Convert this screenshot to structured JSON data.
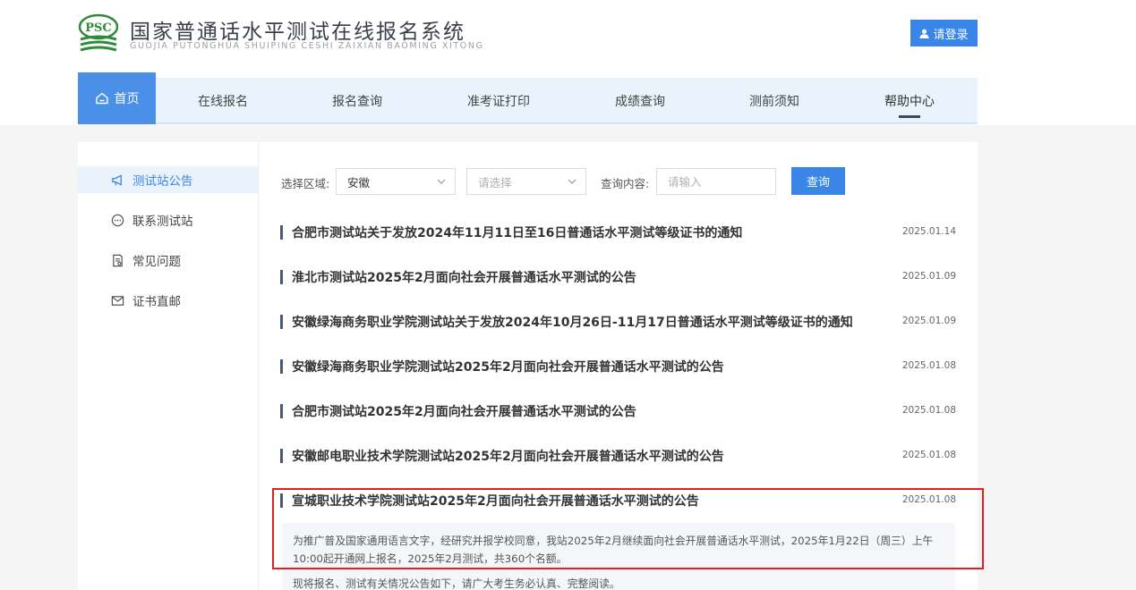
{
  "header": {
    "logo_mark": "PSC",
    "title": "国家普通话水平测试在线报名系统",
    "subtitle": "GUOJIA PUTONGHUA SHUIPING CESHI ZAIXIAN BAOMING XITONG",
    "login_label": "请登录",
    "login_icon": "user-icon"
  },
  "nav": {
    "items": [
      {
        "label": "首页",
        "icon": "home-icon",
        "state": "selected"
      },
      {
        "label": "在线报名"
      },
      {
        "label": "报名查询"
      },
      {
        "label": "准考证打印"
      },
      {
        "label": "成绩查询"
      },
      {
        "label": "测前须知"
      },
      {
        "label": "帮助中心",
        "state": "underlined"
      }
    ]
  },
  "sidebar": {
    "items": [
      {
        "label": "测试站公告",
        "icon": "megaphone-icon",
        "active": true
      },
      {
        "label": "联系测试站",
        "icon": "chat-icon"
      },
      {
        "label": "常见问题",
        "icon": "document-icon"
      },
      {
        "label": "证书直邮",
        "icon": "mail-icon"
      }
    ]
  },
  "filters": {
    "region_label": "选择区域:",
    "region_value": "安徽",
    "city_placeholder": "请选择",
    "query_label": "查询内容:",
    "query_placeholder": "请输入",
    "query_button": "查询"
  },
  "notices": [
    {
      "title": "合肥市测试站关于发放2024年11月11日至16日普通话水平测试等级证书的通知",
      "date": "2025.01.14"
    },
    {
      "title": "淮北市测试站2025年2月面向社会开展普通话水平测试的公告",
      "date": "2025.01.09"
    },
    {
      "title": "安徽绿海商务职业学院测试站关于发放2024年10月26日-11月17日普通话水平测试等级证书的通知",
      "date": "2025.01.09"
    },
    {
      "title": "安徽绿海商务职业学院测试站2025年2月面向社会开展普通话水平测试的公告",
      "date": "2025.01.08"
    },
    {
      "title": "合肥市测试站2025年2月面向社会开展普通话水平测试的公告",
      "date": "2025.01.08"
    },
    {
      "title": "安徽邮电职业技术学院测试站2025年2月面向社会开展普通话水平测试的公告",
      "date": "2025.01.08"
    },
    {
      "title": "宣城职业技术学院测试站2025年2月面向社会开展普通话水平测试的公告",
      "date": "2025.01.08"
    }
  ],
  "expanded_summary": {
    "paragraph1": "为推广普及国家通用语言文字，经研究并报学校同意，我站2025年2月继续面向社会开展普通话水平测试，2025年1月22日（周三）上午10:00起开通网上报名，2025年2月测试，共360个名额。",
    "paragraph2": "现将报名、测试有关情况公告如下，请广大考生务必认真、完整阅读。"
  },
  "colors": {
    "brand_blue": "#3a86e8",
    "nav_bg": "#eaf3fc",
    "highlight_red": "#e02020",
    "logo_green": "#2e8b3a"
  }
}
